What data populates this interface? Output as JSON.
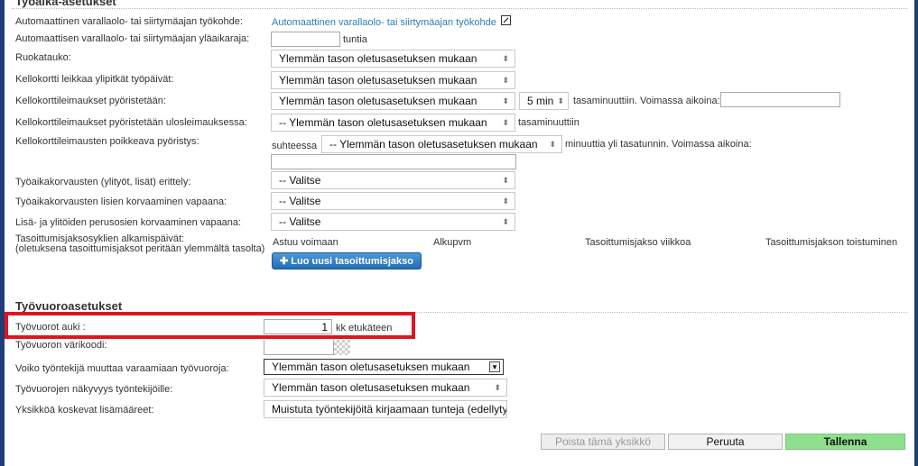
{
  "work_section": {
    "title": "Työaika-asetukset",
    "rows": {
      "standby_tool": {
        "label": "Automaattinen varallaolo- tai siirtymäajan työkohde:",
        "link": "Automaattinen varallaolo- tai siirtymäajan työkohde"
      },
      "standby_limit": {
        "label": "Automaattisen varallaolo- tai siirtymäajan yläaikaraja:",
        "unit": "tuntia",
        "value": ""
      },
      "lunch": {
        "label": "Ruokatauko:",
        "select": "Ylemmän tason oletusasetuksen mukaan"
      },
      "clock_cut": {
        "label": "Kellokortti leikkaa ylipitkät työpäivät:",
        "select": "Ylemmän tason oletusasetuksen mukaan"
      },
      "rounding": {
        "label": "Kellokorttileimaukset pyöristetään:",
        "select": "Ylemmän tason oletusasetuksen mukaan",
        "minutes": "5 min",
        "text": "tasaminuuttiin. Voimassa aikoina:"
      },
      "rounding_out": {
        "label": "Kellokorttileimaukset pyöristetään ulosleimauksessa:",
        "select": "-- Ylemmän tason oletusasetuksen mukaan",
        "text": "tasaminuuttiin"
      },
      "deviating": {
        "label": "Kellokorttileimausten poikkeava pyöristys:",
        "prefix": "suhteessa",
        "select": "-- Ylemmän tason oletusasetuksen mukaan",
        "text": "minuuttia yli tasatunnin. Voimassa aikoina:"
      },
      "comp_split": {
        "label": "Työaikakorvausten (ylityöt, lisät) erittely:",
        "select": "-- Valitse"
      },
      "comp_leave": {
        "label": "Työaikakorvausten lisien korvaaminen vapaana:",
        "select": "-- Valitse"
      },
      "base_leave": {
        "label": "Lisä- ja ylitöiden perusosien korvaaminen vapaana:",
        "select": "-- Valitse"
      },
      "periods": {
        "label_line1": "Tasoittumisjaksosyklien alkamispäivät:",
        "label_line2": "(oletuksena tasoittumisjaksot peritään ylemmältä tasolta)",
        "columns": [
          "Astuu voimaan",
          "Alkupvm",
          "Tasoittumisjakso viikkoa",
          "Tasoittumisjakson toistuminen"
        ],
        "new_button": "Luo uusi tasoittumisjakso"
      }
    }
  },
  "shift_section": {
    "title": "Työvuoroasetukset",
    "rows": {
      "open": {
        "label": "Työvuorot auki :",
        "value": "1",
        "unit": "kk etukäteen"
      },
      "color": {
        "label": "Työvuoron värikoodi:"
      },
      "modify": {
        "label": "Voiko työntekijä muuttaa varaamiaan työvuoroja:",
        "select": "Ylemmän tason oletusasetuksen mukaan"
      },
      "visibility": {
        "label": "Työvuorojen näkyvyys työntekijöille:",
        "select": "Ylemmän tason oletusasetuksen mukaan"
      },
      "extra": {
        "label": "Yksikköä koskevat lisämääreet:",
        "select": "Muistuta työntekijöitä kirjaamaan tunteja (edellytykset: t"
      }
    }
  },
  "footer": {
    "delete": "Poista tämä yksikkö",
    "cancel": "Peruuta",
    "save": "Tallenna"
  },
  "colors": {
    "frame": "#1c3f78",
    "highlight": "#e0151f",
    "save": "#8ee08e",
    "link": "#2a7fb8"
  }
}
